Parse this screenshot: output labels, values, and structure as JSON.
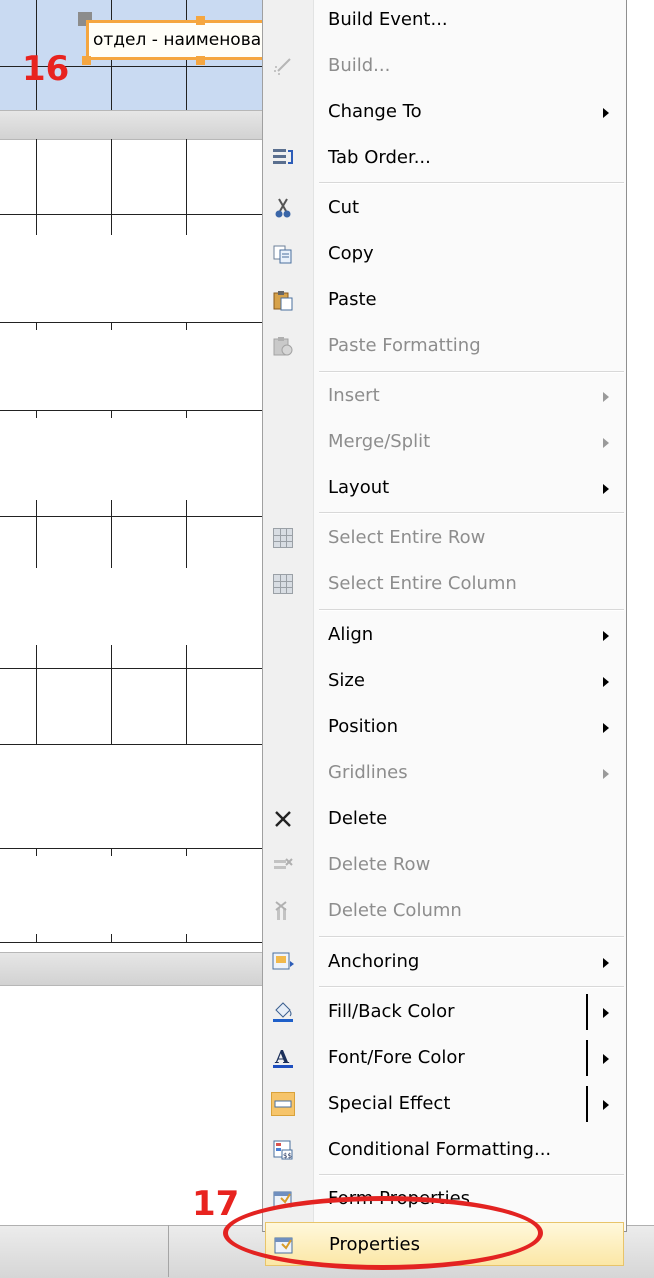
{
  "designer": {
    "field_label": "отдел - наименование",
    "step_16": "16",
    "step_17": "17"
  },
  "menu": {
    "items": [
      {
        "label": "Build Event...",
        "icon": "none",
        "disabled": false,
        "submenu": false
      },
      {
        "label": "Build...",
        "icon": "magic-wand-icon",
        "disabled": true,
        "submenu": false
      },
      {
        "label": "Change To",
        "icon": "none",
        "disabled": false,
        "submenu": true
      },
      {
        "label": "Tab Order...",
        "icon": "tab-order-icon",
        "disabled": false,
        "submenu": false
      },
      {
        "label": "Cut",
        "icon": "scissors-icon",
        "disabled": false,
        "submenu": false
      },
      {
        "label": "Copy",
        "icon": "copy-icon",
        "disabled": false,
        "submenu": false
      },
      {
        "label": "Paste",
        "icon": "paste-icon",
        "disabled": false,
        "submenu": false
      },
      {
        "label": "Paste Formatting",
        "icon": "paste-formatting-icon",
        "disabled": true,
        "submenu": false
      },
      {
        "label": "Insert",
        "icon": "none",
        "disabled": true,
        "submenu": true
      },
      {
        "label": "Merge/Split",
        "icon": "none",
        "disabled": true,
        "submenu": true
      },
      {
        "label": "Layout",
        "icon": "none",
        "disabled": false,
        "submenu": true
      },
      {
        "label": "Select Entire Row",
        "icon": "select-row-icon",
        "disabled": true,
        "submenu": false
      },
      {
        "label": "Select Entire Column",
        "icon": "select-column-icon",
        "disabled": true,
        "submenu": false
      },
      {
        "label": "Align",
        "icon": "none",
        "disabled": false,
        "submenu": true
      },
      {
        "label": "Size",
        "icon": "none",
        "disabled": false,
        "submenu": true
      },
      {
        "label": "Position",
        "icon": "none",
        "disabled": false,
        "submenu": true
      },
      {
        "label": "Gridlines",
        "icon": "none",
        "disabled": true,
        "submenu": true
      },
      {
        "label": "Delete",
        "icon": "delete-x-icon",
        "disabled": false,
        "submenu": false
      },
      {
        "label": "Delete Row",
        "icon": "delete-row-icon",
        "disabled": true,
        "submenu": false
      },
      {
        "label": "Delete Column",
        "icon": "delete-column-icon",
        "disabled": true,
        "submenu": false
      },
      {
        "label": "Anchoring",
        "icon": "anchoring-icon",
        "disabled": false,
        "submenu": true
      },
      {
        "label": "Fill/Back Color",
        "icon": "fill-bucket-icon",
        "disabled": false,
        "submenu": true
      },
      {
        "label": "Font/Fore Color",
        "icon": "font-color-icon",
        "disabled": false,
        "submenu": true
      },
      {
        "label": "Special Effect",
        "icon": "special-effect-icon",
        "disabled": false,
        "submenu": true
      },
      {
        "label": "Conditional Formatting...",
        "icon": "conditional-formatting-icon",
        "disabled": false,
        "submenu": false
      },
      {
        "label": "Form Properties",
        "icon": "form-properties-icon",
        "disabled": false,
        "submenu": false
      },
      {
        "label": "Properties",
        "icon": "properties-icon",
        "disabled": false,
        "submenu": false,
        "highlighted": true
      }
    ]
  },
  "colors": {
    "highlight_annotation": "#e32321",
    "selection_border": "#f5a640",
    "header_band": "#c9daf2"
  }
}
